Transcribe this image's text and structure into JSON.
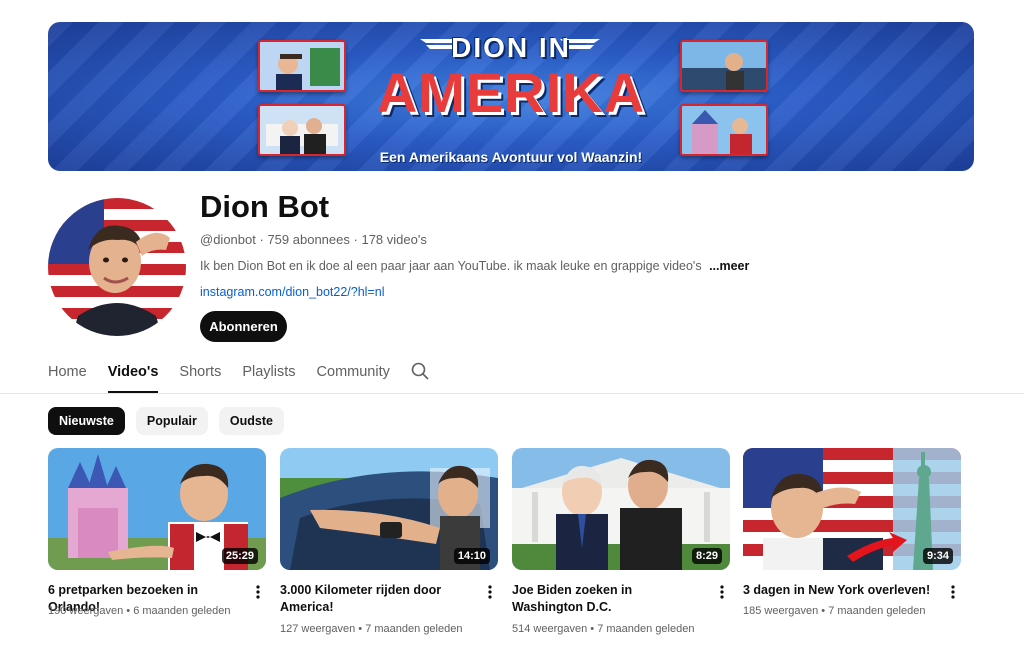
{
  "banner": {
    "title_line1": "DION IN",
    "title_line2": "AMERIKA",
    "tagline": "Een Amerikaans Avontuur vol Waanzin!"
  },
  "channel": {
    "name": "Dion Bot",
    "handle": "@dionbot",
    "subscribers": "759 abonnees",
    "video_count": "178 video's",
    "description": "Ik ben Dion Bot en ik doe al een paar jaar aan YouTube. ik maak leuke en grappige video's",
    "more_label": "...meer",
    "link": "instagram.com/dion_bot22/?hl=nl",
    "subscribe_label": "Abonneren",
    "separator": "·"
  },
  "tabs": [
    {
      "label": "Home",
      "active": false
    },
    {
      "label": "Video's",
      "active": true
    },
    {
      "label": "Shorts",
      "active": false
    },
    {
      "label": "Playlists",
      "active": false
    },
    {
      "label": "Community",
      "active": false
    }
  ],
  "chips": [
    {
      "label": "Nieuwste",
      "active": true
    },
    {
      "label": "Populair",
      "active": false
    },
    {
      "label": "Oudste",
      "active": false
    }
  ],
  "videos": [
    {
      "title": "6 pretparken bezoeken in Orlando!",
      "views": "190 weergaven",
      "age": "6 maanden geleden",
      "duration": "25:29"
    },
    {
      "title": "3.000 Kilometer rijden door America!",
      "views": "127 weergaven",
      "age": "7 maanden geleden",
      "duration": "14:10"
    },
    {
      "title": "Joe Biden zoeken in Washington D.C.",
      "views": "514 weergaven",
      "age": "7 maanden geleden",
      "duration": "8:29"
    },
    {
      "title": "3 dagen in New York overleven!",
      "views": "185 weergaven",
      "age": "7 maanden geleden",
      "duration": "9:34"
    }
  ],
  "meta_separator": "•",
  "icons": {
    "search": "search-icon",
    "more": "more-vert-icon"
  },
  "colors": {
    "link": "#065fd4",
    "banner_blue": "#2a5cc8",
    "accent_red": "#e83b3b"
  }
}
